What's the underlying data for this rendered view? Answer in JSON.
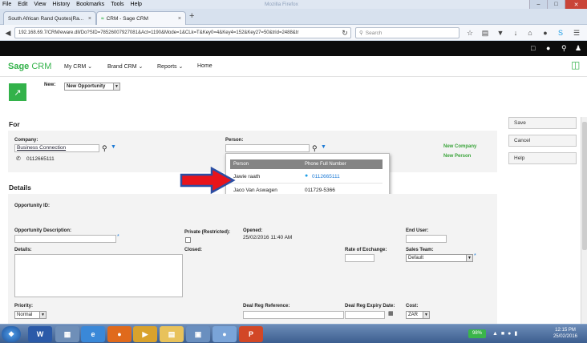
{
  "browser": {
    "menu": [
      "File",
      "Edit",
      "View",
      "History",
      "Bookmarks",
      "Tools",
      "Help"
    ],
    "window_title": "Mozilla Firefox",
    "tabs": [
      {
        "label": "South African Rand Quotes|Ra..."
      },
      {
        "label": "CRM - Sage CRM"
      }
    ],
    "url": "192.168.69.7/CRM/eware.dll/Do?SID=78526007927081&Act=1190&Mode=1&CLk=T&Key0=4&Key4=152&Key27=50&trid=2488&tr",
    "search_placeholder": "Search"
  },
  "sage": {
    "logo_sage": "Sage",
    "logo_crm": "CRM",
    "nav": [
      "My CRM",
      "Brand CRM",
      "Reports",
      "Home"
    ]
  },
  "new_bar": {
    "label": "New:",
    "selected": "New Opportunity"
  },
  "for_section": {
    "title": "For",
    "company_label": "Company:",
    "company_value": "Business Connection",
    "company_phone": "0112665111",
    "person_label": "Person:",
    "new_company": "New Company",
    "new_person": "New Person"
  },
  "person_popup": {
    "headers": [
      "Person",
      "Phone Full Number"
    ],
    "rows": [
      {
        "person": "Jawie raath",
        "phone": "0112665111"
      },
      {
        "person": "Jaco Van Aswagen",
        "phone": "011729-5366"
      }
    ]
  },
  "details_section": {
    "title": "Details",
    "opportunity_id": "Opportunity ID:",
    "opportunity_description": "Opportunity Description:",
    "private": "Private (Restricted):",
    "opened_label": "Opened:",
    "opened_value": "25/02/2016 11:40 AM",
    "end_user": "End User:",
    "details": "Details:",
    "closed": "Closed:",
    "rate_of_exchange": "Rate of Exchange:",
    "sales_team_label": "Sales Team:",
    "sales_team_value": "Default",
    "priority_label": "Priority:",
    "priority_value": "Normal",
    "deal_reg_reference": "Deal Reg Reference:",
    "deal_reg_expiry": "Deal Reg Expiry Date:",
    "cost_label": "Cost:",
    "cost_value": "ZAR"
  },
  "actions": {
    "save": "Save",
    "cancel": "Cancel",
    "help": "Help"
  },
  "taskbar": {
    "battery": "98%",
    "time": "12:15 PM",
    "date": "25/02/2016"
  },
  "colors": {
    "accent_green": "#33b24a",
    "arrow_red": "#e8141b",
    "arrow_outline": "#2b4ea3"
  }
}
